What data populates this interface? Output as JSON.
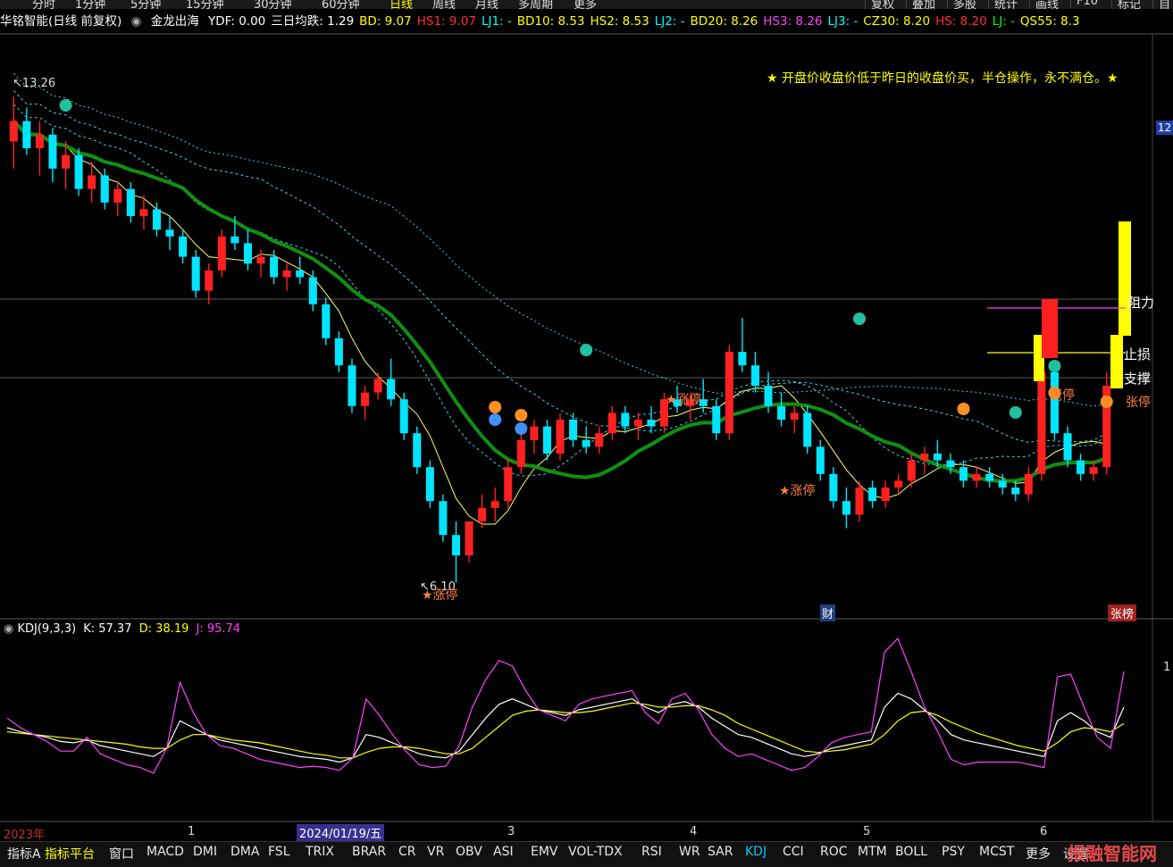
{
  "toolbar": {
    "periods": [
      "分时",
      "1分钟",
      "5分钟",
      "15分钟",
      "30分钟",
      "60分钟",
      "日线",
      "周线",
      "月线",
      "多周期",
      "更多"
    ],
    "active_period": "日线",
    "right_buttons": [
      "复权",
      "叠加",
      "多股",
      "统计",
      "画线",
      "F10",
      "标记",
      "自选"
    ]
  },
  "infobar": {
    "stock": "华铭智能(日线 前复权)",
    "indicator": "金龙出海",
    "items": [
      {
        "label": "YDF: 0.00",
        "color": "#ffffff"
      },
      {
        "label": "三日均跌: 1.29",
        "color": "#ffffff"
      },
      {
        "label": "BD: 9.07",
        "color": "#ffff00"
      },
      {
        "label": "HS1: 9.07",
        "color": "#ff3030"
      },
      {
        "label": "LJ1: -",
        "color": "#00ffff"
      },
      {
        "label": "BD10: 8.53",
        "color": "#ffff00"
      },
      {
        "label": "HS2: 8.53",
        "color": "#ffff00"
      },
      {
        "label": "LJ2: -",
        "color": "#00ffff"
      },
      {
        "label": "BD20: 8.26",
        "color": "#ffff00"
      },
      {
        "label": "HS3: 8.26",
        "color": "#ff40ff"
      },
      {
        "label": "LJ3: -",
        "color": "#00ffff"
      },
      {
        "label": "CZ30: 8.20",
        "color": "#ffff00"
      },
      {
        "label": "HS: 8.20",
        "color": "#ff3030"
      },
      {
        "label": "LJ: -",
        "color": "#00ff00"
      },
      {
        "label": "QS55: 8.3",
        "color": "#ffff00"
      }
    ]
  },
  "notice": "★ 开盘价收盘价低于昨日的收盘价买，半仓操作，永不满仓。★",
  "annotations": {
    "high_label": "13.26",
    "low_label": "6.10",
    "limit_up": "★涨停",
    "limit_up_right": "张停",
    "support": "支撑",
    "stop_loss": "止损",
    "pressure": "阻力",
    "right_axis_label": "12",
    "cai_badge": "财",
    "zhangbang_badge": "张榜"
  },
  "kdj": {
    "title": "KDJ(9,3,3)",
    "k_label": "K: 57.37",
    "d_label": "D: 38.19",
    "j_label": "J: 95.74",
    "axis_label": "1"
  },
  "xaxis": {
    "labels": [
      "2023年",
      "1",
      "2024/01/19/五",
      "3",
      "4",
      "5",
      "6"
    ]
  },
  "bottom_tabs": [
    "指标A",
    "指标平台",
    "窗口",
    "MACD",
    "DMI",
    "DMA",
    "FSL",
    "TRIX",
    "BRAR",
    "CR",
    "VR",
    "OBV",
    "ASI",
    "EMV",
    "VOL-TDX",
    "RSI",
    "WR",
    "SAR",
    "KDJ",
    "CCI",
    "ROC",
    "MTM",
    "BOLL",
    "PSY",
    "MCST",
    "更多",
    "设置"
  ],
  "active_bottom_tab": "KDJ",
  "watermark": "报融智能网",
  "colors": {
    "up": "#ff2020",
    "down": "#00e5ff",
    "ma_green": "#109010",
    "k": "#ffffff",
    "d": "#ffff00",
    "j": "#ff40ff"
  },
  "chart_data": {
    "type": "candlestick",
    "ohlc": [
      [
        12.6,
        13.26,
        12.2,
        12.9
      ],
      [
        12.9,
        13.1,
        12.4,
        12.5
      ],
      [
        12.5,
        12.9,
        12.1,
        12.7
      ],
      [
        12.7,
        12.8,
        12.0,
        12.2
      ],
      [
        12.2,
        12.6,
        11.9,
        12.4
      ],
      [
        12.4,
        12.5,
        11.8,
        11.9
      ],
      [
        11.9,
        12.3,
        11.7,
        12.1
      ],
      [
        12.1,
        12.2,
        11.6,
        11.7
      ],
      [
        11.7,
        12.0,
        11.5,
        11.9
      ],
      [
        11.9,
        12.0,
        11.4,
        11.5
      ],
      [
        11.5,
        11.8,
        11.3,
        11.6
      ],
      [
        11.6,
        11.7,
        11.2,
        11.3
      ],
      [
        11.3,
        11.5,
        11.0,
        11.2
      ],
      [
        11.2,
        11.3,
        10.8,
        10.9
      ],
      [
        10.9,
        11.0,
        10.3,
        10.4
      ],
      [
        10.4,
        10.8,
        10.2,
        10.7
      ],
      [
        10.7,
        11.3,
        10.6,
        11.2
      ],
      [
        11.2,
        11.5,
        11.0,
        11.1
      ],
      [
        11.1,
        11.3,
        10.7,
        10.8
      ],
      [
        10.8,
        11.0,
        10.6,
        10.9
      ],
      [
        10.9,
        11.0,
        10.5,
        10.6
      ],
      [
        10.6,
        10.8,
        10.4,
        10.7
      ],
      [
        10.7,
        10.9,
        10.5,
        10.6
      ],
      [
        10.6,
        10.7,
        10.1,
        10.2
      ],
      [
        10.2,
        10.3,
        9.6,
        9.7
      ],
      [
        9.7,
        9.8,
        9.2,
        9.3
      ],
      [
        9.3,
        9.4,
        8.6,
        8.7
      ],
      [
        8.7,
        9.0,
        8.5,
        8.9
      ],
      [
        8.9,
        9.2,
        8.8,
        9.1
      ],
      [
        9.1,
        9.4,
        8.7,
        8.8
      ],
      [
        8.8,
        8.9,
        8.2,
        8.3
      ],
      [
        8.3,
        8.4,
        7.7,
        7.8
      ],
      [
        7.8,
        7.9,
        7.2,
        7.3
      ],
      [
        7.3,
        7.4,
        6.7,
        6.8
      ],
      [
        6.8,
        7.0,
        6.1,
        6.5
      ],
      [
        6.5,
        7.0,
        6.4,
        7.0
      ],
      [
        7.0,
        7.4,
        6.9,
        7.2
      ],
      [
        7.2,
        7.5,
        7.0,
        7.3
      ],
      [
        7.3,
        7.9,
        7.2,
        7.8
      ],
      [
        7.8,
        8.3,
        7.7,
        8.2
      ],
      [
        8.2,
        8.5,
        8.0,
        8.4
      ],
      [
        8.4,
        8.5,
        7.9,
        8.0
      ],
      [
        8.0,
        8.6,
        7.9,
        8.5
      ],
      [
        8.5,
        8.6,
        8.1,
        8.2
      ],
      [
        8.2,
        8.4,
        8.0,
        8.1
      ],
      [
        8.1,
        8.4,
        8.0,
        8.3
      ],
      [
        8.3,
        8.7,
        8.2,
        8.6
      ],
      [
        8.6,
        8.7,
        8.3,
        8.4
      ],
      [
        8.4,
        8.6,
        8.2,
        8.5
      ],
      [
        8.5,
        8.7,
        8.3,
        8.4
      ],
      [
        8.4,
        8.9,
        8.3,
        8.8
      ],
      [
        8.8,
        9.0,
        8.6,
        8.7
      ],
      [
        8.7,
        8.9,
        8.5,
        8.8
      ],
      [
        8.8,
        9.1,
        8.6,
        8.7
      ],
      [
        8.7,
        8.8,
        8.2,
        8.3
      ],
      [
        8.3,
        9.6,
        8.2,
        9.5
      ],
      [
        9.5,
        10.0,
        9.2,
        9.3
      ],
      [
        9.3,
        9.5,
        8.9,
        9.0
      ],
      [
        9.0,
        9.2,
        8.6,
        8.7
      ],
      [
        8.7,
        8.9,
        8.4,
        8.5
      ],
      [
        8.5,
        8.7,
        8.3,
        8.6
      ],
      [
        8.6,
        8.7,
        8.0,
        8.1
      ],
      [
        8.1,
        8.2,
        7.6,
        7.7
      ],
      [
        7.7,
        7.8,
        7.2,
        7.3
      ],
      [
        7.3,
        7.5,
        6.9,
        7.1
      ],
      [
        7.1,
        7.6,
        7.0,
        7.5
      ],
      [
        7.5,
        7.6,
        7.2,
        7.3
      ],
      [
        7.3,
        7.6,
        7.2,
        7.5
      ],
      [
        7.5,
        7.7,
        7.4,
        7.6
      ],
      [
        7.6,
        8.0,
        7.5,
        7.9
      ],
      [
        7.9,
        8.1,
        7.7,
        8.0
      ],
      [
        8.0,
        8.2,
        7.8,
        7.9
      ],
      [
        7.9,
        8.0,
        7.7,
        7.8
      ],
      [
        7.8,
        7.9,
        7.5,
        7.6
      ],
      [
        7.6,
        7.8,
        7.5,
        7.7
      ],
      [
        7.7,
        7.8,
        7.5,
        7.6
      ],
      [
        7.6,
        7.7,
        7.4,
        7.5
      ],
      [
        7.5,
        7.6,
        7.3,
        7.4
      ],
      [
        7.4,
        7.8,
        7.3,
        7.7
      ],
      [
        7.7,
        9.4,
        7.6,
        9.2
      ],
      [
        9.2,
        9.3,
        8.2,
        8.3
      ],
      [
        8.3,
        8.4,
        7.8,
        7.9
      ],
      [
        7.9,
        8.0,
        7.6,
        7.7
      ],
      [
        7.7,
        7.9,
        7.6,
        7.8
      ],
      [
        7.8,
        9.2,
        7.7,
        9.0
      ]
    ],
    "ylim": [
      6.0,
      13.5
    ]
  },
  "kdj_data": {
    "k": [
      55,
      52,
      50,
      48,
      45,
      44,
      46,
      42,
      40,
      38,
      36,
      34,
      40,
      60,
      55,
      50,
      46,
      44,
      42,
      40,
      38,
      36,
      34,
      33,
      32,
      30,
      33,
      50,
      48,
      44,
      40,
      36,
      34,
      33,
      38,
      50,
      62,
      72,
      76,
      72,
      68,
      66,
      64,
      68,
      70,
      72,
      74,
      76,
      70,
      66,
      72,
      74,
      70,
      62,
      56,
      50,
      48,
      44,
      40,
      36,
      34,
      36,
      40,
      42,
      44,
      46,
      70,
      80,
      76,
      68,
      60,
      50,
      46,
      44,
      42,
      40,
      38,
      36,
      34,
      60,
      66,
      60,
      52,
      48,
      70
    ],
    "d": [
      52,
      51,
      50,
      49,
      48,
      47,
      46,
      45,
      44,
      43,
      41,
      40,
      40,
      46,
      50,
      50,
      48,
      46,
      45,
      44,
      42,
      40,
      38,
      36,
      35,
      33,
      33,
      37,
      40,
      41,
      41,
      40,
      38,
      36,
      36,
      40,
      48,
      56,
      64,
      67,
      68,
      67,
      66,
      66,
      67,
      69,
      71,
      73,
      72,
      70,
      70,
      71,
      71,
      68,
      64,
      58,
      54,
      50,
      46,
      42,
      38,
      37,
      38,
      39,
      41,
      43,
      50,
      60,
      66,
      67,
      64,
      59,
      55,
      51,
      48,
      45,
      42,
      40,
      38,
      44,
      52,
      55,
      54,
      52,
      58
    ],
    "j": [
      62,
      55,
      50,
      45,
      38,
      38,
      48,
      36,
      32,
      28,
      26,
      22,
      40,
      88,
      66,
      50,
      42,
      40,
      36,
      32,
      30,
      28,
      26,
      27,
      26,
      24,
      33,
      76,
      64,
      50,
      38,
      28,
      26,
      27,
      42,
      70,
      90,
      104,
      100,
      82,
      68,
      64,
      60,
      72,
      76,
      78,
      80,
      82,
      66,
      58,
      76,
      80,
      68,
      50,
      40,
      34,
      36,
      32,
      28,
      24,
      26,
      34,
      44,
      48,
      50,
      52,
      110,
      120,
      96,
      70,
      52,
      32,
      28,
      30,
      30,
      30,
      30,
      28,
      26,
      92,
      94,
      70,
      48,
      40,
      96
    ],
    "ylim": [
      -10,
      120
    ]
  }
}
